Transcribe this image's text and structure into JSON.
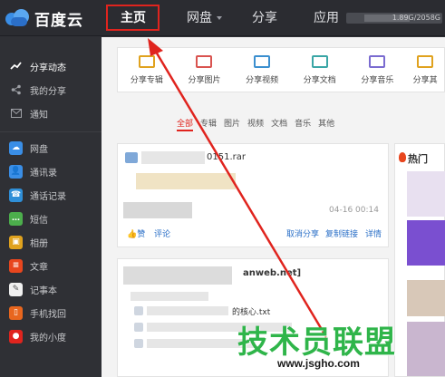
{
  "app": {
    "name": "百度云"
  },
  "topnav": {
    "home": "主页",
    "pan": "网盘",
    "share": "分享",
    "app": "应用",
    "quota": "1.89G/2058G"
  },
  "sidebar": {
    "items": [
      {
        "label": "分享动态",
        "icon": "trend-icon"
      },
      {
        "label": "我的分享",
        "icon": "share-icon"
      },
      {
        "label": "通知",
        "icon": "mail-icon"
      },
      {
        "label": "网盘",
        "icon": "cloud-icon"
      },
      {
        "label": "通讯录",
        "icon": "contacts-icon"
      },
      {
        "label": "通话记录",
        "icon": "call-log-icon"
      },
      {
        "label": "短信",
        "icon": "sms-icon"
      },
      {
        "label": "相册",
        "icon": "album-icon"
      },
      {
        "label": "文章",
        "icon": "article-icon"
      },
      {
        "label": "记事本",
        "icon": "notepad-icon"
      },
      {
        "label": "手机找回",
        "icon": "phone-find-icon"
      },
      {
        "label": "我的小度",
        "icon": "xiaodu-icon"
      }
    ]
  },
  "toolbar": {
    "items": [
      {
        "label": "分享专辑",
        "color": "#e0a21e"
      },
      {
        "label": "分享图片",
        "color": "#d9534f"
      },
      {
        "label": "分享视频",
        "color": "#3b8fcf"
      },
      {
        "label": "分享文档",
        "color": "#3aa6a6"
      },
      {
        "label": "分享音乐",
        "color": "#7a6bd0"
      },
      {
        "label": "分享其",
        "color": "#e0a21e"
      }
    ]
  },
  "filter": [
    "全部",
    "专辑",
    "图片",
    "视频",
    "文档",
    "音乐",
    "其他"
  ],
  "feed": [
    {
      "filename": "0151.rar",
      "time": "04-16 00:14",
      "like": "赞",
      "comment": "评论",
      "cancel": "取消分享",
      "copy": "复制链接",
      "detail": "详情"
    },
    {
      "title": "anweb.net]",
      "file1": "的核心.txt"
    }
  ],
  "hot": {
    "title": "热门"
  },
  "watermark": {
    "text": "技术员联盟",
    "url": "www.jsgho.com"
  },
  "colors": {
    "accent": "#e0241e",
    "link": "#2a6fc7",
    "watermark": "#2fb54a"
  }
}
